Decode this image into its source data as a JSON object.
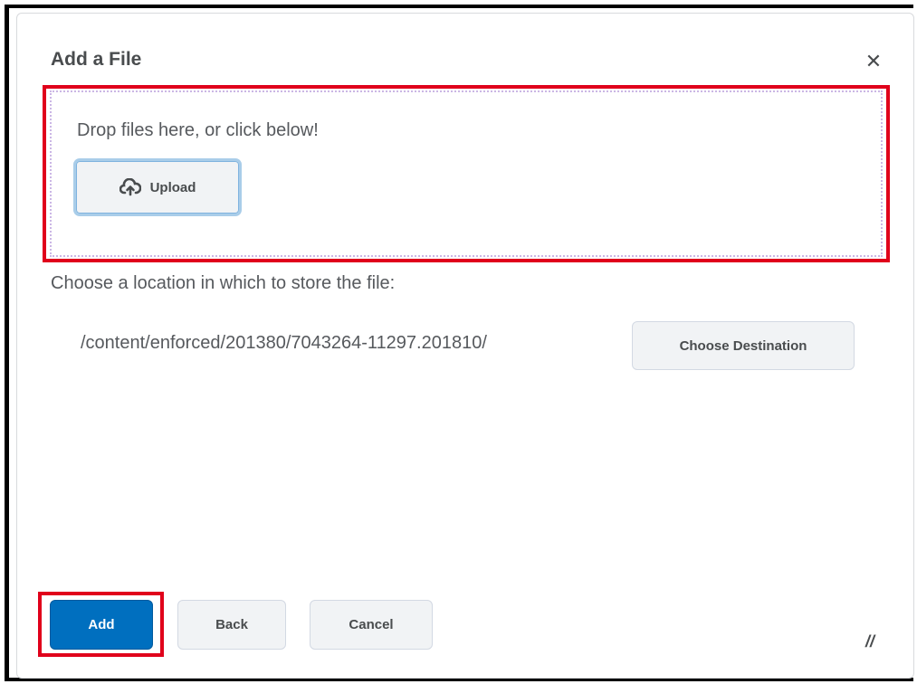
{
  "dialog": {
    "title": "Add a File",
    "close_icon": "close-icon"
  },
  "dropzone": {
    "prompt": "Drop files here, or click below!",
    "upload_label": "Upload",
    "upload_icon": "cloud-upload-icon"
  },
  "location": {
    "prompt": "Choose a location in which to store the file:",
    "path": "/content/enforced/201380/7043264-11297.201810/",
    "choose_destination_label": "Choose Destination"
  },
  "footer": {
    "add_label": "Add",
    "back_label": "Back",
    "cancel_label": "Cancel",
    "resize_icon": "resize-handle-icon"
  },
  "colors": {
    "primary": "#006fbf",
    "highlight": "#e0001b",
    "text": "#494c4e"
  }
}
